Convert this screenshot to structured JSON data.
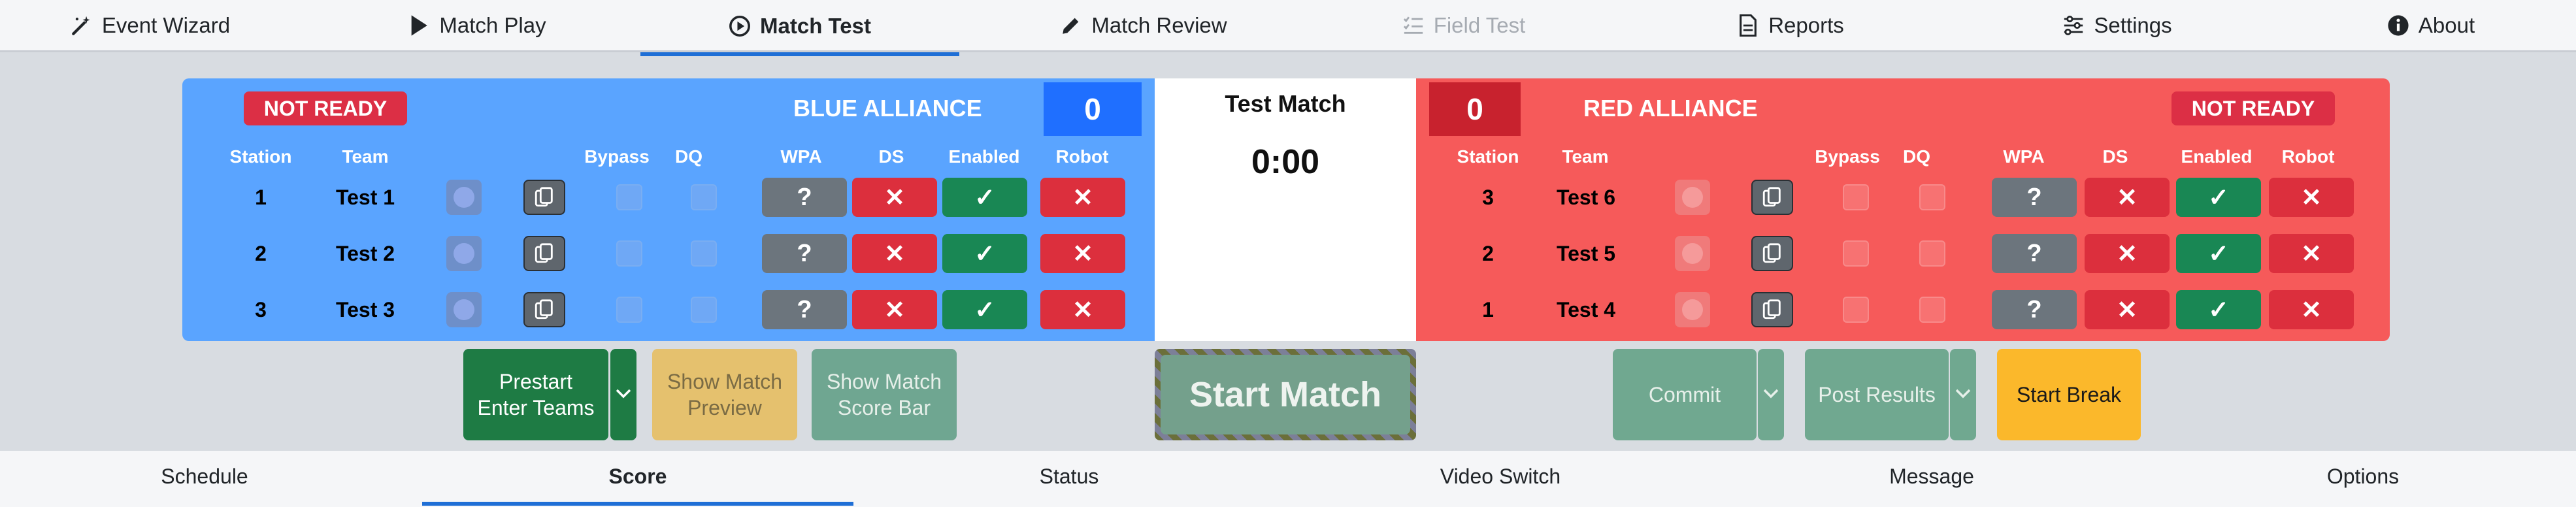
{
  "topnav": {
    "items": [
      {
        "label": "Event Wizard",
        "icon": "magic-wand-icon"
      },
      {
        "label": "Match Play",
        "icon": "play-icon"
      },
      {
        "label": "Match Test",
        "icon": "play-circle-icon",
        "active": true
      },
      {
        "label": "Match Review",
        "icon": "pencil-icon"
      },
      {
        "label": "Field Test",
        "icon": "checklist-icon",
        "disabled": true
      },
      {
        "label": "Reports",
        "icon": "document-icon"
      },
      {
        "label": "Settings",
        "icon": "sliders-icon"
      },
      {
        "label": "About",
        "icon": "info-icon"
      }
    ]
  },
  "blue": {
    "status": "NOT READY",
    "title": "BLUE ALLIANCE",
    "score": "0",
    "headers": {
      "station": "Station",
      "team": "Team",
      "bypass": "Bypass",
      "dq": "DQ",
      "wpa": "WPA",
      "ds": "DS",
      "enabled": "Enabled",
      "robot": "Robot"
    },
    "rows": [
      {
        "station": "1",
        "team": "Test 1",
        "wpa": "?"
      },
      {
        "station": "2",
        "team": "Test 2",
        "wpa": "?"
      },
      {
        "station": "3",
        "team": "Test 3",
        "wpa": "?"
      }
    ]
  },
  "center": {
    "match_name": "Test Match",
    "timer": "0:00"
  },
  "red": {
    "status": "NOT READY",
    "title": "RED ALLIANCE",
    "score": "0",
    "headers": {
      "station": "Station",
      "team": "Team",
      "bypass": "Bypass",
      "dq": "DQ",
      "wpa": "WPA",
      "ds": "DS",
      "enabled": "Enabled",
      "robot": "Robot"
    },
    "rows": [
      {
        "station": "3",
        "team": "Test 6",
        "wpa": "?"
      },
      {
        "station": "2",
        "team": "Test 5",
        "wpa": "?"
      },
      {
        "station": "1",
        "team": "Test 4",
        "wpa": "?"
      }
    ]
  },
  "controls": {
    "prestart_line1": "Prestart",
    "prestart_line2": "Enter Teams",
    "show_preview_line1": "Show Match",
    "show_preview_line2": "Preview",
    "show_scorebar_line1": "Show Match",
    "show_scorebar_line2": "Score Bar",
    "start_match": "Start Match",
    "commit": "Commit",
    "post_results": "Post Results",
    "start_break": "Start Break"
  },
  "bottomnav": {
    "tabs": [
      {
        "label": "Schedule"
      },
      {
        "label": "Score",
        "active": true
      },
      {
        "label": "Status"
      },
      {
        "label": "Video Switch"
      },
      {
        "label": "Message"
      },
      {
        "label": "Options"
      }
    ]
  },
  "colors": {
    "blue_alliance": "#5aa4ff",
    "red_alliance": "#f65a5a",
    "accent": "#1f6fd6",
    "success": "#198754",
    "danger": "#dc2f3d",
    "warning": "#fbb82b"
  }
}
